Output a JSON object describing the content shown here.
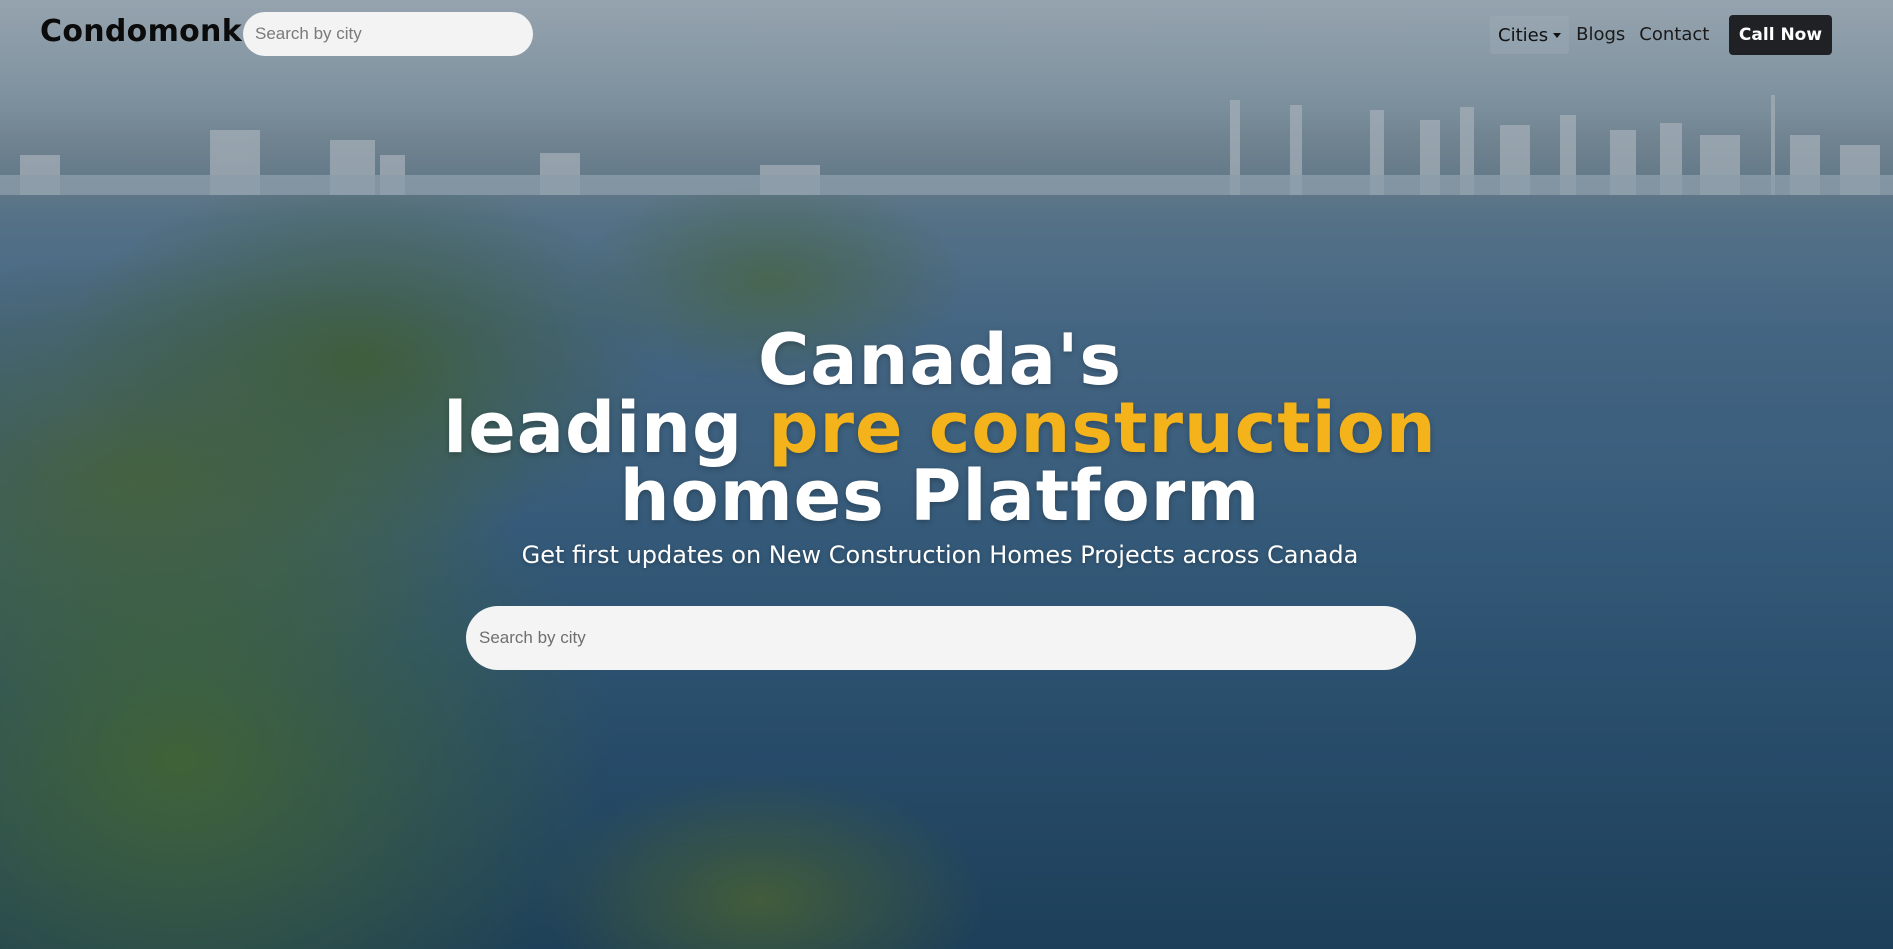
{
  "navbar": {
    "brand": "Condomonk",
    "search_placeholder": "Search by city",
    "links": {
      "cities": "Cities",
      "blogs": "Blogs",
      "contact": "Contact"
    },
    "call_button": "Call Now"
  },
  "hero": {
    "title_line1": "Canada's",
    "title_line2_plain": "leading ",
    "title_line2_accent": "pre construction",
    "title_line3": "homes Platform",
    "subtitle": "Get first updates on New Construction Homes Projects across Canada",
    "search_placeholder": "Search by city"
  },
  "colors": {
    "accent": "#f4b21b",
    "button_bg": "#1f2124",
    "text_on_hero": "#ffffff"
  },
  "icons": {
    "dropdown": "caret-down-icon"
  }
}
